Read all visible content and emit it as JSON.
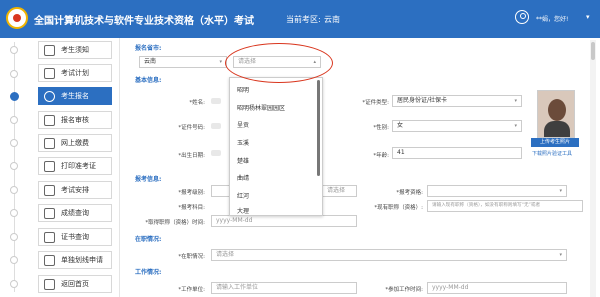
{
  "header": {
    "title": "全国计算机技术与软件专业技术资格（水平）考试",
    "region_label": "当前考区:",
    "region_value": "云南",
    "greeting": "**娟，您好!",
    "caret": "▾"
  },
  "sidebar": {
    "items": [
      {
        "label": "考生须知",
        "icon": "notice-icon"
      },
      {
        "label": "考试计划",
        "icon": "calendar-icon"
      },
      {
        "label": "考生报名",
        "icon": "clock-icon",
        "active": true
      },
      {
        "label": "报名审核",
        "icon": "audit-icon"
      },
      {
        "label": "网上缴费",
        "icon": "payment-icon"
      },
      {
        "label": "打印准考证",
        "icon": "printer-icon"
      },
      {
        "label": "考试安排",
        "icon": "schedule-icon"
      },
      {
        "label": "成绩查询",
        "icon": "search-icon"
      },
      {
        "label": "证书查询",
        "icon": "certificate-icon"
      },
      {
        "label": "单独划线申请",
        "icon": "apply-icon"
      },
      {
        "label": "返回首页",
        "icon": "home-icon"
      }
    ]
  },
  "form": {
    "section_region": "报名省市:",
    "province_value": "云南",
    "city_placeholder": "请选择",
    "section_basic": "基本信息:",
    "name_label": "*姓名:",
    "cert_type_label": "*证件类型:",
    "cert_type_value": "居民身份证/社保卡",
    "cert_no_label": "*证件号码:",
    "gender_label": "*性别:",
    "gender_value": "女",
    "birth_label": "*出生日期:",
    "age_label": "*年龄:",
    "age_value": "41",
    "upload_button": "上传考生照片",
    "download_link": "下载照片验证工具",
    "section_exam": "报考信息:",
    "exam_level_label": "*报考级别:",
    "exam_level_placeholder": "请选择",
    "exam_qual_label": "*报考资格:",
    "exam_subject_label": "*报考科目:",
    "current_title_label": "*现有职称（资格）:",
    "current_title_placeholder": "请输入现有职称（资格），如没有职称则填写“无”或者",
    "title_date_label": "*取得职称（资格）时间:",
    "title_date_placeholder": "yyyy-MM-dd",
    "section_status": "在职情况:",
    "status_label": "*在职情况:",
    "status_placeholder": "请选择",
    "section_work": "工作情况:",
    "work_unit_label": "*工作单位:",
    "work_unit_placeholder": "请输入工作单位",
    "work_date_label": "*参加工作时间:",
    "work_date_placeholder": "yyyy-MM-dd"
  },
  "dropdown": {
    "options": [
      "昭明",
      "昭明杨林翠园园区",
      "呈贡",
      "玉溪",
      "楚雄",
      "曲靖",
      "红河",
      "大理"
    ]
  },
  "colors": {
    "primary": "#2c6fc1",
    "highlight": "#d9361e"
  }
}
